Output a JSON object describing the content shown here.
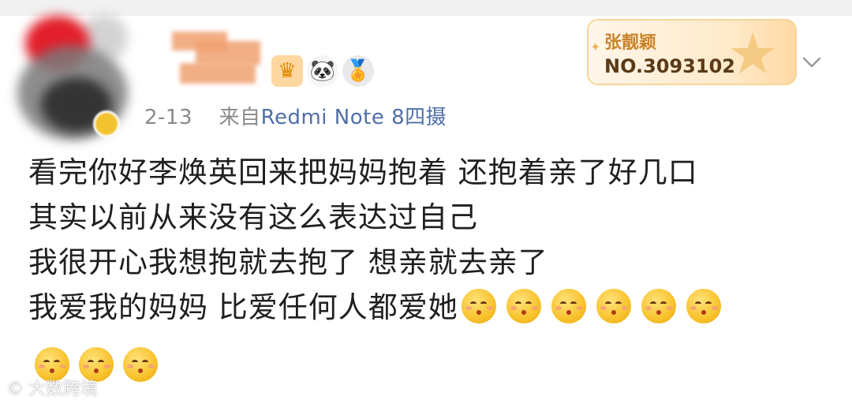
{
  "post": {
    "meta": {
      "date": "2-13",
      "source_prefix": "来自",
      "source": "Redmi Note 8四摄"
    },
    "fan_card": {
      "name": "张靓颖",
      "number": "NO.3093102"
    },
    "badges": {
      "crown": "♛",
      "panda": "🐼",
      "medal": "🏅"
    },
    "lines": [
      "看完你好李焕英回来把妈妈抱着  还抱着亲了好几口",
      "其实以前从来没有这么表达过自己",
      "我很开心我想抱就去抱了  想亲就去亲了",
      "我爱我的妈妈  比爱任何人都爱她"
    ],
    "emoji_name": "kissing-face-emoji"
  },
  "watermark": {
    "logo": "©",
    "text": "大数跨境"
  },
  "colors": {
    "source_link": "#4f6fa5",
    "meta": "#8a8a8a",
    "fan_card_text": "#c8842a"
  }
}
